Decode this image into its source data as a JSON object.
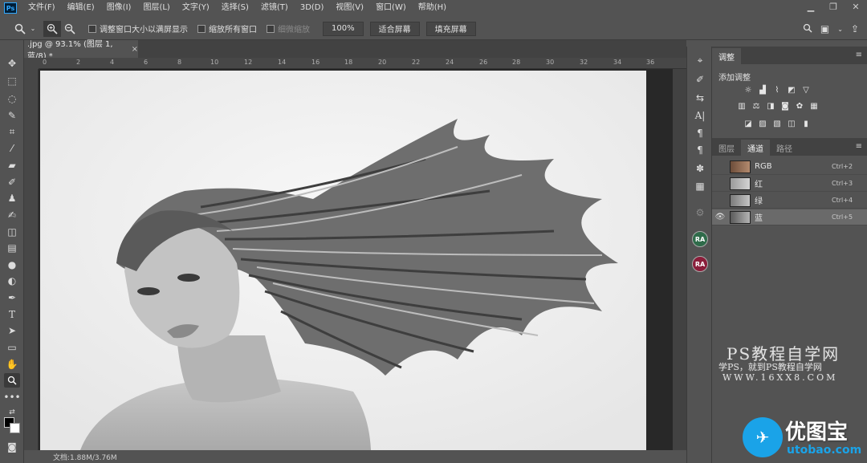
{
  "app": {
    "logo": "Ps"
  },
  "menu": [
    "文件(F)",
    "编辑(E)",
    "图像(I)",
    "图层(L)",
    "文字(Y)",
    "选择(S)",
    "滤镜(T)",
    "3D(D)",
    "视图(V)",
    "窗口(W)",
    "帮助(H)"
  ],
  "window_controls": {
    "minimize": "▁",
    "restore": "❐",
    "close": "✕"
  },
  "options": {
    "resize_windows": "调整窗口大小以满屏显示",
    "zoom_all": "缩放所有窗口",
    "scrubby": "细微缩放",
    "zoom_100": "100%",
    "fit_screen": "适合屏幕",
    "fill_screen": "填充屏幕"
  },
  "document": {
    "tab_title": ".jpg @ 93.1% (图层 1, 蓝/8) *",
    "close": "×",
    "status": "文档:1.88M/3.76M"
  },
  "ruler": {
    "labels": [
      "0",
      "2",
      "4",
      "6",
      "8",
      "10",
      "12",
      "14",
      "16",
      "18",
      "20",
      "22",
      "24",
      "26",
      "28",
      "30",
      "32",
      "34",
      "36"
    ]
  },
  "adjustments": {
    "tab": "调整",
    "title": "添加调整"
  },
  "channels_panel": {
    "tabs": [
      "图层",
      "通道",
      "路径"
    ],
    "active_tab": 1,
    "rows": [
      {
        "name": "RGB",
        "shortcut": "Ctrl+2",
        "thumb": "#8a6a55",
        "visible": false
      },
      {
        "name": "红",
        "shortcut": "Ctrl+3",
        "thumb": "#b8b8b8",
        "visible": false
      },
      {
        "name": "绿",
        "shortcut": "Ctrl+4",
        "thumb": "#9a9a9a",
        "visible": false
      },
      {
        "name": "蓝",
        "shortcut": "Ctrl+5",
        "thumb": "#7a7a7a",
        "visible": true
      }
    ]
  },
  "plugins": {
    "ra1": "RA",
    "ra2": "RA"
  },
  "watermark": {
    "line1": "PS教程自学网",
    "line2": "学PS，就到PS教程自学网",
    "line3": "WWW.16XX8.COM",
    "brand": "优图宝",
    "brand_url": "utobao.com"
  },
  "colors": {
    "accent": "#1aa3e8",
    "bg": "#535353"
  }
}
